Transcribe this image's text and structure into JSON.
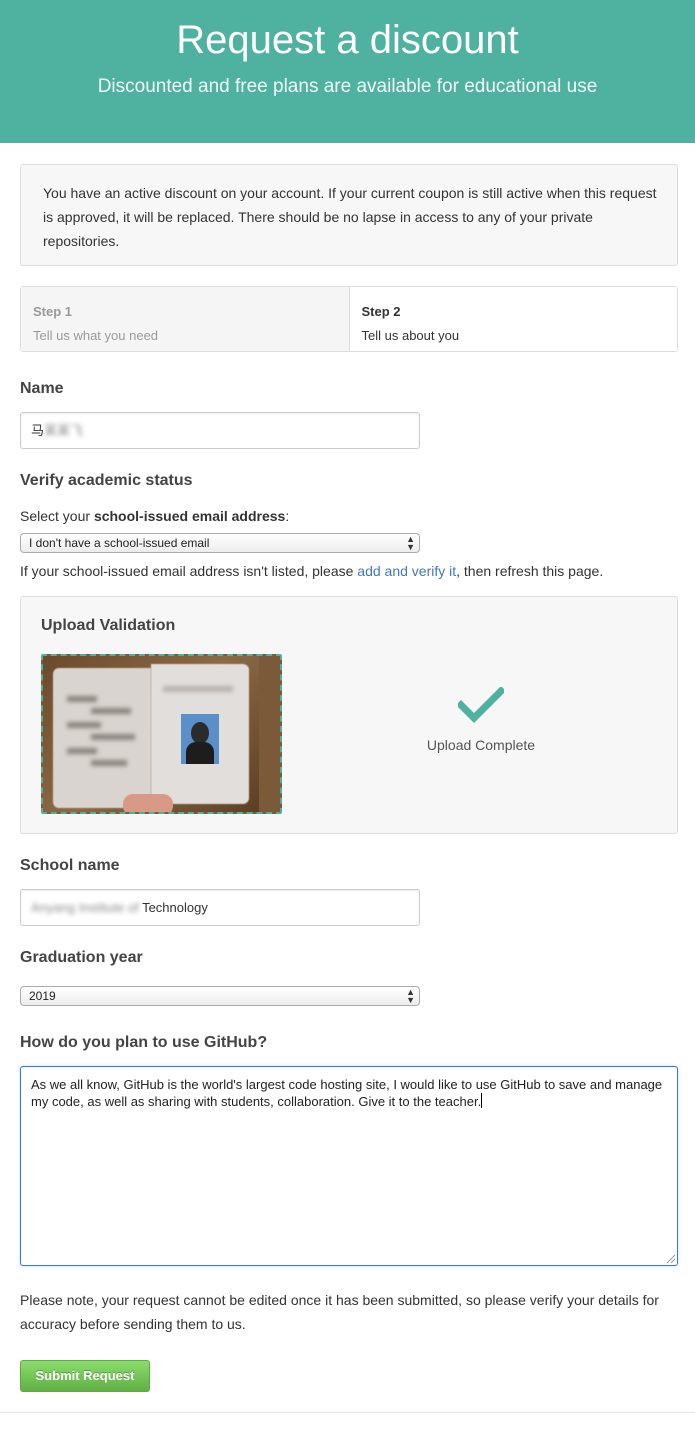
{
  "header": {
    "title": "Request a discount",
    "subtitle": "Discounted and free plans are available for educational use",
    "background_color": "#4fb19f"
  },
  "notice": {
    "text": "You have an active discount on your account. If your current coupon is still active when this request is approved, it will be replaced. There should be no lapse in access to any of your private repositories."
  },
  "steps": [
    {
      "number": "Step 1",
      "description": "Tell us what you need",
      "state": "inactive"
    },
    {
      "number": "Step 2",
      "description": "Tell us about you",
      "state": "active"
    }
  ],
  "name": {
    "label": "Name",
    "value_visible": "马",
    "value_redacted": "某某飞"
  },
  "academic": {
    "label": "Verify academic status",
    "select_prompt_before": "Select your ",
    "select_prompt_bold": "school-issued email address",
    "select_prompt_after": ":",
    "email_select_value": "I don't have a school-issued email",
    "help_before": "If your school-issued email address isn't listed, please ",
    "help_link": "add and verify it",
    "help_after": ", then refresh this page."
  },
  "upload": {
    "title": "Upload Validation",
    "status": "Upload Complete",
    "check_icon": "checkmark-icon",
    "accent_color": "#4fb19f"
  },
  "school": {
    "label": "School name",
    "value_redacted": "Anyang Institute of",
    "value_visible": "Technology"
  },
  "graduation": {
    "label": "Graduation year",
    "select_value": "2019"
  },
  "usage": {
    "label": "How do you plan to use GitHub?",
    "text": "As we all know, GitHub is the world's largest code hosting site, I would like to use GitHub to save and manage my code, as well as sharing with students, collaboration. Give it to the teacher."
  },
  "footer_note": "Please note, your request cannot be edited once it has been submitted, so please verify your details for accuracy before sending them to us.",
  "submit_label": "Submit Request"
}
